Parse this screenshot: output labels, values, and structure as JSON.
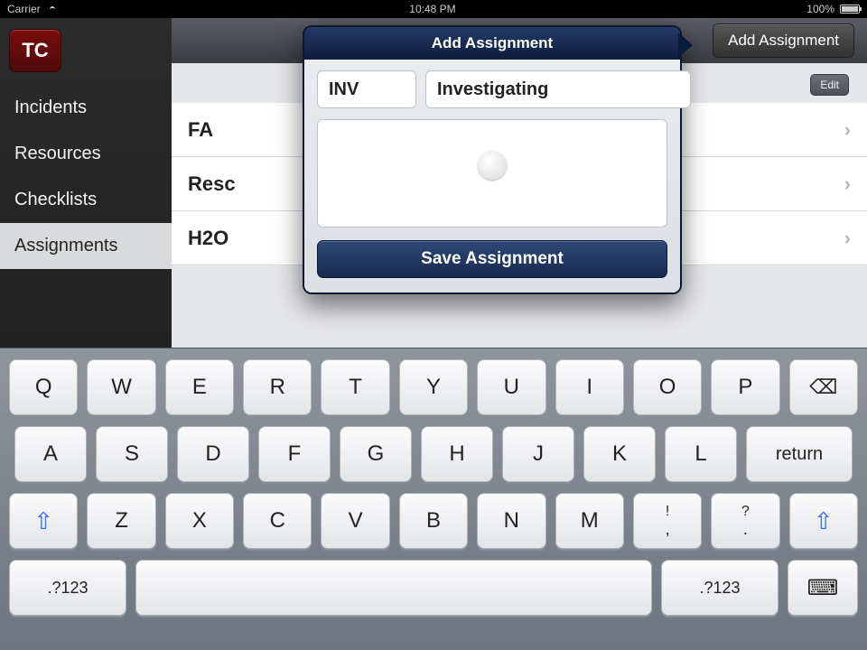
{
  "statusbar": {
    "carrier": "Carrier",
    "time": "10:48 PM",
    "battery": "100%"
  },
  "app_logo": "TC",
  "sidebar": {
    "items": [
      {
        "label": "Incidents"
      },
      {
        "label": "Resources"
      },
      {
        "label": "Checklists"
      },
      {
        "label": "Assignments"
      }
    ],
    "selected_index": 3
  },
  "header": {
    "add_button": "Add Assignment"
  },
  "edit_button": "Edit",
  "assignments": [
    {
      "code": "FA"
    },
    {
      "code": "Resc"
    },
    {
      "code": "H2O"
    }
  ],
  "popover": {
    "title": "Add Assignment",
    "code_value": "INV",
    "name_value": "Investigating",
    "notes_value": "",
    "save_label": "Save Assignment"
  },
  "keyboard": {
    "row1": [
      "Q",
      "W",
      "E",
      "R",
      "T",
      "Y",
      "U",
      "I",
      "O",
      "P"
    ],
    "row2": [
      "A",
      "S",
      "D",
      "F",
      "G",
      "H",
      "J",
      "K",
      "L"
    ],
    "row3": [
      "Z",
      "X",
      "C",
      "V",
      "B",
      "N",
      "M"
    ],
    "punct1_top": "!",
    "punct1_bot": ",",
    "punct2_top": "?",
    "punct2_bot": ".",
    "return": "return",
    "mode": ".?123",
    "backspace": "⌫",
    "shift": "⇧",
    "hide": "⌨"
  }
}
